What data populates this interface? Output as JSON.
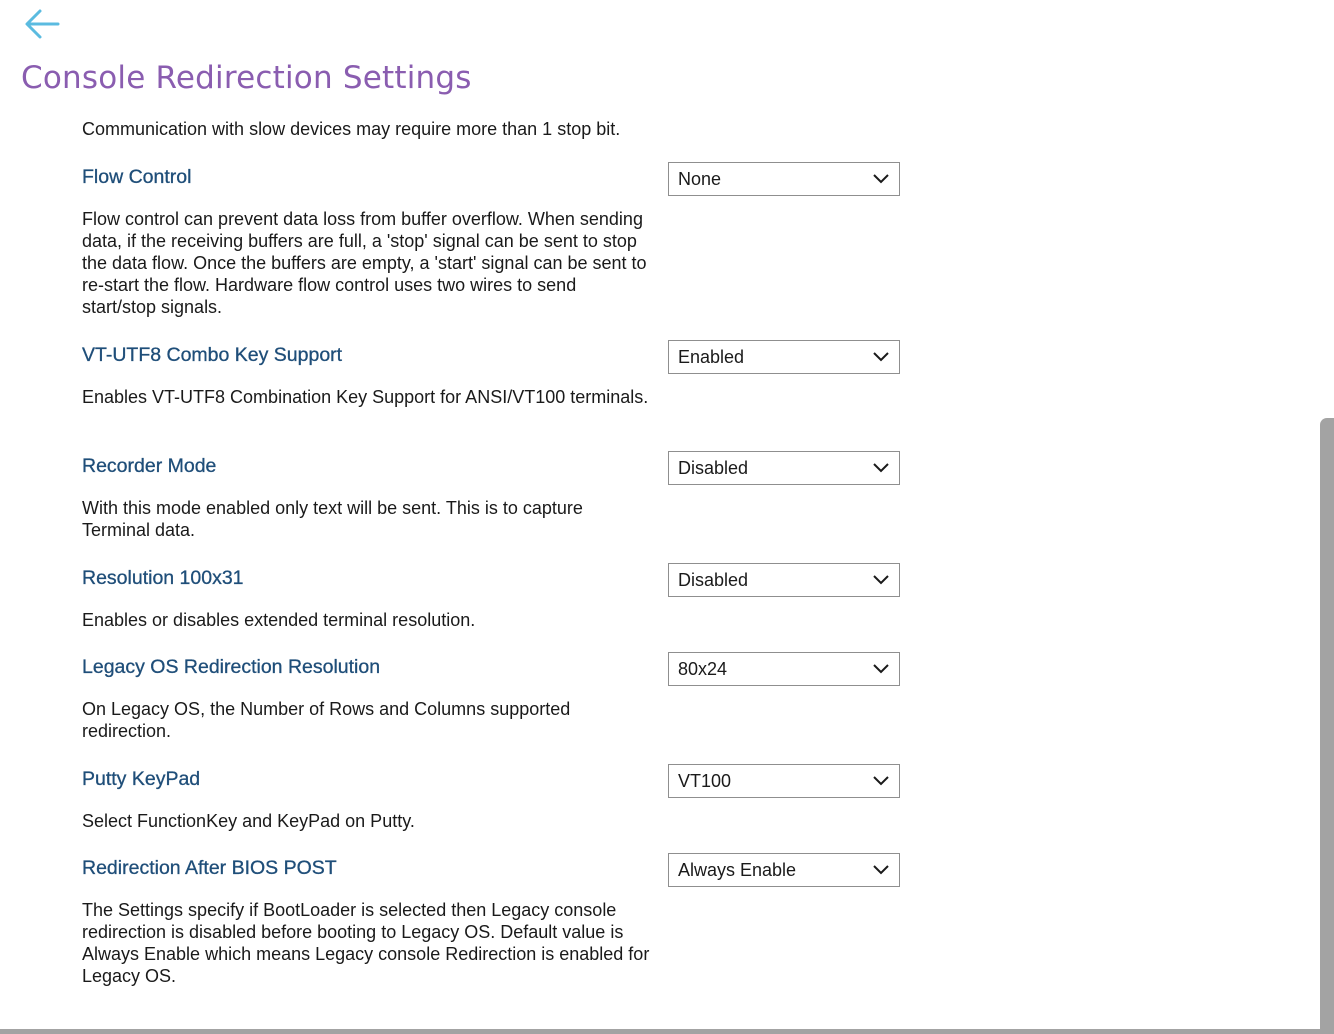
{
  "header": {
    "back_icon": "arrow-left-icon",
    "title": "Console Redirection Settings",
    "title_color": "#8a5db0",
    "accent_color": "#5bbbe0"
  },
  "partial_text": "Communication with slow devices may require more than 1 stop bit.",
  "settings": [
    {
      "label": "Flow Control",
      "value": "None",
      "description": "Flow control can prevent data loss from buffer overflow. When sending data, if the receiving buffers are full, a 'stop' signal can be sent to stop the data flow. Once the buffers are empty, a 'start' signal can be sent to re-start the flow. Hardware flow control uses two wires to send start/stop signals."
    },
    {
      "label": "VT-UTF8 Combo Key Support",
      "value": "Enabled",
      "description": "Enables VT-UTF8 Combination Key Support for ANSI/VT100 terminals."
    },
    {
      "label": "Recorder Mode",
      "value": "Disabled",
      "description": "With this mode enabled only text will be sent. This is to capture Terminal data."
    },
    {
      "label": "Resolution 100x31",
      "value": "Disabled",
      "description": "Enables or disables extended terminal resolution."
    },
    {
      "label": "Legacy OS Redirection Resolution",
      "value": "80x24",
      "description": "On Legacy OS, the Number of Rows and Columns supported redirection."
    },
    {
      "label": "Putty KeyPad",
      "value": "VT100",
      "description": "Select FunctionKey and KeyPad on Putty."
    },
    {
      "label": "Redirection After BIOS POST",
      "value": "Always Enable",
      "description": "The Settings specify if BootLoader is selected then Legacy console redirection is disabled before booting to Legacy OS. Default value is Always Enable which means Legacy console Redirection is enabled for Legacy OS."
    }
  ],
  "dropdown_icon": "chevron-down-icon"
}
